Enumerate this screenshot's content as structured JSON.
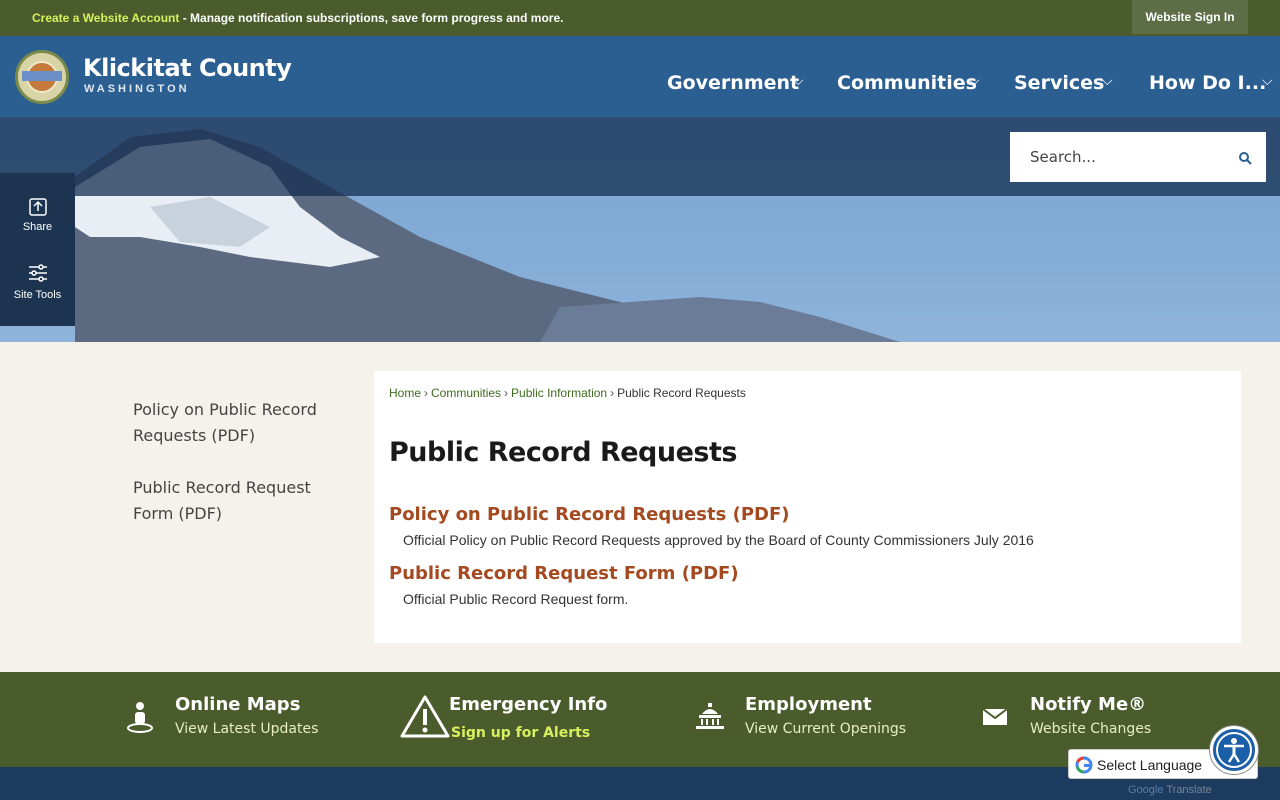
{
  "topbar": {
    "create_account": "Create a Website Account",
    "message": " - Manage notification subscriptions, save form progress and more.",
    "sign_in": "Website Sign In"
  },
  "header": {
    "title": "Klickitat County",
    "subtitle": "WASHINGTON",
    "nav": [
      "Government",
      "Communities",
      "Services",
      "How Do I..."
    ]
  },
  "search": {
    "placeholder": "Search..."
  },
  "tools": {
    "share": "Share",
    "site_tools": "Site Tools"
  },
  "sidebar": {
    "items": [
      "Policy on Public Record Requests (PDF)",
      "Public Record Request Form (PDF)"
    ]
  },
  "breadcrumb": {
    "home": "Home",
    "communities": "Communities",
    "public_information": "Public Information",
    "current": "Public Record Requests",
    "separator": "›"
  },
  "main": {
    "title": "Public Record Requests",
    "documents": [
      {
        "title": "Policy on Public Record Requests (PDF)",
        "description": "Official Policy on Public Record Requests approved by the Board of County Commissioners July 2016"
      },
      {
        "title": "Public Record Request Form (PDF)",
        "description": "Official Public Record Request form."
      }
    ]
  },
  "quick_links": [
    {
      "title": "Online Maps",
      "subtitle": "View Latest Updates",
      "icon": "map-pin-person-icon"
    },
    {
      "title": "Emergency Info",
      "subtitle": "Sign up for Alerts",
      "icon": "warning-triangle-icon"
    },
    {
      "title": "Employment",
      "subtitle": "View Current Openings",
      "icon": "capitol-building-icon"
    },
    {
      "title": "Notify Me®",
      "subtitle": "Website Changes",
      "icon": "envelope-icon"
    }
  ],
  "translate": {
    "label": "Select Language",
    "powered_google": "Google",
    "powered_translate": "Translate"
  },
  "colors": {
    "topbar": "#4a5c2c",
    "header": "#2b5e91",
    "link": "#a34a20",
    "breadcrumb_link": "#3d6b1f"
  }
}
